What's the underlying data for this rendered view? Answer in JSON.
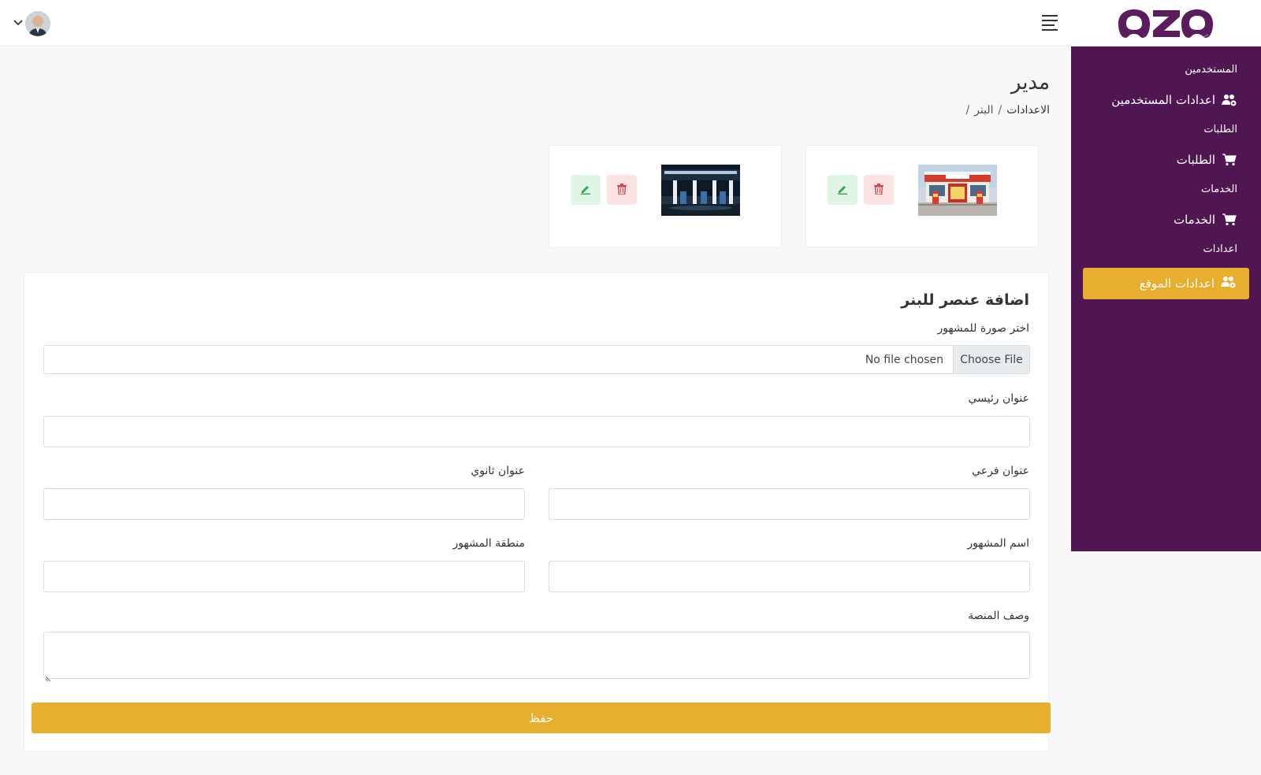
{
  "header": {
    "logo_text": "OZO",
    "menu_icon": "hamburger-icon",
    "user_menu_icon": "chevron-down-icon"
  },
  "sidebar": {
    "sections": [
      {
        "heading": "المستخدمين",
        "item_label": "اعدادات المستخدمين",
        "item_icon": "users-cog-icon"
      },
      {
        "heading": "الطلبات",
        "item_label": "الطلبات",
        "item_icon": "shopping-cart-icon"
      },
      {
        "heading": "الخدمات",
        "item_label": "الخدمات",
        "item_icon": "shopping-cart-icon"
      },
      {
        "heading": "اعدادات",
        "item_label": "اعدادات الموقع",
        "item_icon": "users-cog-icon"
      }
    ],
    "active_index": 3
  },
  "page": {
    "title": "مدير",
    "breadcrumb": {
      "parent": "الاعدادات",
      "current": "البنر",
      "separator": "/"
    }
  },
  "banners": [
    {
      "image": "gas-station-day",
      "delete_icon": "trash-icon",
      "edit_icon": "pencil-icon"
    },
    {
      "image": "gas-station-night",
      "delete_icon": "trash-icon",
      "edit_icon": "pencil-icon"
    }
  ],
  "form": {
    "title": "اضافة عنصر للبنر",
    "image_label": "اختر صورة للمشهور",
    "file_button": "Choose File",
    "file_status": "No file chosen",
    "main_title_label": "عنوان رئيسي",
    "subtitle_label": "عنوان فرعي",
    "secondary_title_label": "عنوان ثانوي",
    "celebrity_name_label": "اسم المشهور",
    "celebrity_area_label": "منطقة المشهور",
    "description_label": "وصف المنصة",
    "save_label": "حفظ"
  },
  "colors": {
    "sidebar_bg": "#4f1652",
    "accent": "#e8ae2d",
    "logo": "#5b1c5e",
    "delete_bg": "#fde4e4",
    "delete_icon": "#e0454b",
    "edit_bg": "#e0f5e6",
    "edit_icon": "#2ea44f"
  }
}
